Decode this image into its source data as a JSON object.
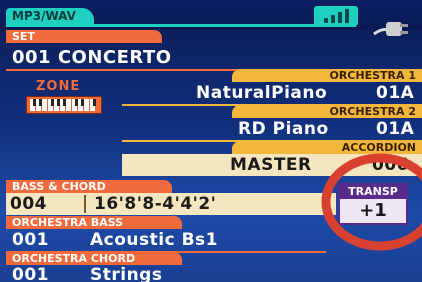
{
  "header": {
    "mode_label": "MP3/WAV"
  },
  "set": {
    "label": "SET",
    "value": "001 CONCERTO"
  },
  "zone": {
    "label": "ZONE"
  },
  "orchestra1": {
    "label": "ORCHESTRA 1",
    "sound": "NaturalPiano",
    "code": "01A"
  },
  "orchestra2": {
    "label": "ORCHESTRA 2",
    "sound": "RD Piano",
    "code": "01A"
  },
  "accordion": {
    "label": "ACCORDION",
    "value": "MASTER",
    "code": "006"
  },
  "bass_chord": {
    "label": "BASS & CHORD",
    "number": "004",
    "registration": "16'8'8-4'4'2'"
  },
  "transp": {
    "label": "TRANSP",
    "value": "+1"
  },
  "orchestra_bass": {
    "label": "ORCHESTRA BASS",
    "number": "001",
    "sound": "Acoustic Bs1"
  },
  "orchestra_chord": {
    "label": "ORCHESTRA CHORD",
    "number": "001",
    "sound": "Strings"
  },
  "colors": {
    "orange": "#f06a3b",
    "yellow": "#f3b73c",
    "teal": "#1fd0c0",
    "highlight": "#d8402f"
  },
  "icons": [
    "signal-bars-icon",
    "power-plug-icon",
    "keyboard-icon"
  ]
}
